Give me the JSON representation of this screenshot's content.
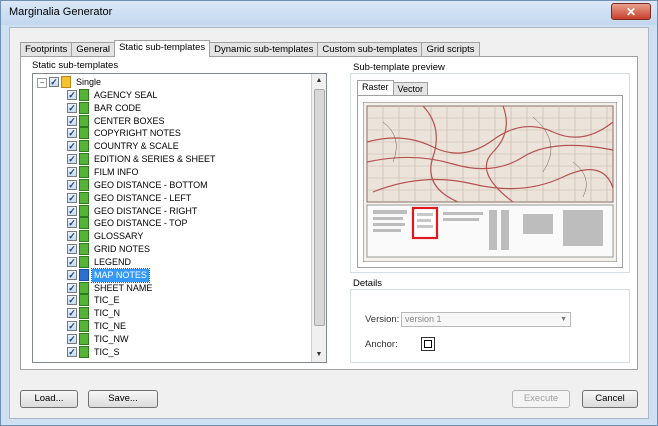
{
  "window": {
    "title": "Marginalia Generator",
    "close_glyph": "✕"
  },
  "tabs": [
    "Footprints",
    "General",
    "Static sub-templates",
    "Dynamic sub-templates",
    "Custom sub-templates",
    "Grid scripts"
  ],
  "active_tab": "Static sub-templates",
  "static_panel": {
    "label": "Static sub-templates",
    "root": {
      "label": "Single",
      "expander": "−",
      "check": "✓"
    },
    "items": [
      "AGENCY SEAL",
      "BAR CODE",
      "CENTER BOXES",
      "COPYRIGHT NOTES",
      "COUNTRY & SCALE",
      "EDITION & SERIES & SHEET",
      "FILM INFO",
      "GEO DISTANCE - BOTTOM",
      "GEO DISTANCE - LEFT",
      "GEO DISTANCE - RIGHT",
      "GEO DISTANCE - TOP",
      "GLOSSARY",
      "GRID NOTES",
      "LEGEND",
      "MAP NOTES",
      "SHEET NAME",
      "TIC_E",
      "TIC_N",
      "TIC_NE",
      "TIC_NW",
      "TIC_S"
    ],
    "selected_item": "MAP NOTES",
    "scroll_up": "▲",
    "scroll_down": "▼"
  },
  "preview": {
    "label": "Sub-template preview",
    "tabs": [
      "Raster",
      "Vector"
    ],
    "active_tab": "Raster"
  },
  "details": {
    "label": "Details",
    "version_label": "Version:",
    "version_value": "version 1",
    "anchor_label": "Anchor:"
  },
  "buttons": {
    "load": "Load...",
    "save": "Save...",
    "execute": "Execute",
    "cancel": "Cancel"
  },
  "colors": {
    "selection": "#3399ff",
    "highlight_box": "#e0191f",
    "map_contour": "#b5544e"
  },
  "icons": {
    "close": "close-icon",
    "check": "checkbox-icon",
    "template": "template-icon",
    "anchor": "anchor-icon"
  }
}
